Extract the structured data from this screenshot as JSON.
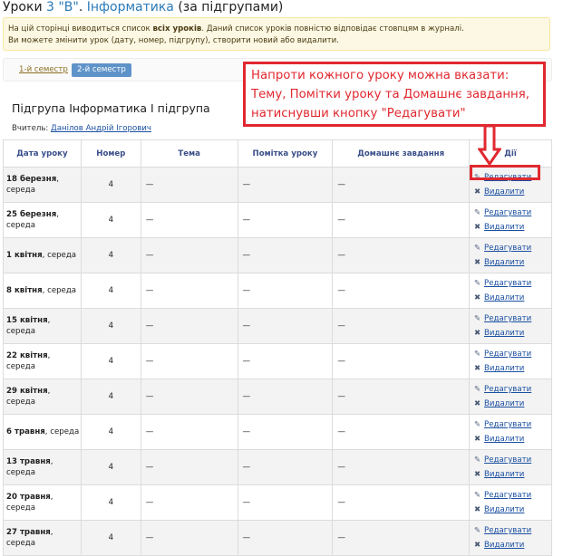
{
  "header": {
    "prefix": "Уроки ",
    "class_name": "3 \"В\"",
    "sep": ". ",
    "subject": "Інформатика",
    "suffix": " (за підгрупами)"
  },
  "info": {
    "line1_a": "На цій сторінці виводиться список ",
    "line1_b": "всіх уроків",
    "line1_c": ". Даний список уроків повністю відповідає стовпцям в журналі.",
    "line2": "Ви можете змінити урок (дату, номер, підгрупу), створити новий або видалити."
  },
  "tabs": {
    "semester1": "1-й семестр",
    "semester2": "2-й семестр"
  },
  "group": {
    "title": "Підгрупа Інформатика I підгрупа",
    "teacher_label": "Вчитель:",
    "teacher_name": "Данілов Андрій Ігорович"
  },
  "callout": "Напроти кожного уроку можна вказати: Тему, Помітки уроку та Домашнє завдання, натиснувши кнопку \"Редагувати\"",
  "table": {
    "headers": {
      "date": "Дата уроку",
      "number": "Номер",
      "topic": "Тема",
      "note": "Помітка уроку",
      "homework": "Домашнє завдання",
      "actions": "Дії"
    },
    "edit_label": "Редагувати",
    "delete_label": "Видалити",
    "rows": [
      {
        "day": "18 березня",
        "weekday": "середа",
        "number": "4",
        "topic": "—",
        "note": "—",
        "homework": "—"
      },
      {
        "day": "25 березня",
        "weekday": "середа",
        "number": "4",
        "topic": "—",
        "note": "—",
        "homework": "—"
      },
      {
        "day": "1 квітня",
        "weekday": "середа",
        "number": "4",
        "topic": "—",
        "note": "—",
        "homework": "—"
      },
      {
        "day": "8 квітня",
        "weekday": "середа",
        "number": "4",
        "topic": "—",
        "note": "—",
        "homework": "—"
      },
      {
        "day": "15 квітня",
        "weekday": "середа",
        "number": "4",
        "topic": "—",
        "note": "—",
        "homework": "—"
      },
      {
        "day": "22 квітня",
        "weekday": "середа",
        "number": "4",
        "topic": "—",
        "note": "—",
        "homework": "—"
      },
      {
        "day": "29 квітня",
        "weekday": "середа",
        "number": "4",
        "topic": "—",
        "note": "—",
        "homework": "—"
      },
      {
        "day": "6 травня",
        "weekday": "середа",
        "number": "4",
        "topic": "—",
        "note": "—",
        "homework": "—"
      },
      {
        "day": "13 травня",
        "weekday": "середа",
        "number": "4",
        "topic": "—",
        "note": "—",
        "homework": "—"
      },
      {
        "day": "20 травня",
        "weekday": "середа",
        "number": "4",
        "topic": "—",
        "note": "—",
        "homework": "—"
      },
      {
        "day": "27 травня",
        "weekday": "середа",
        "number": "4",
        "topic": "—",
        "note": "—",
        "homework": "—"
      }
    ]
  },
  "colors": {
    "accent_blue": "#2a7ab8",
    "highlight_red": "#e0282f",
    "tab_active": "#5e93c9",
    "info_bg": "#fcf8e3"
  },
  "icons": {
    "edit": "edit-icon",
    "delete": "delete-icon"
  }
}
